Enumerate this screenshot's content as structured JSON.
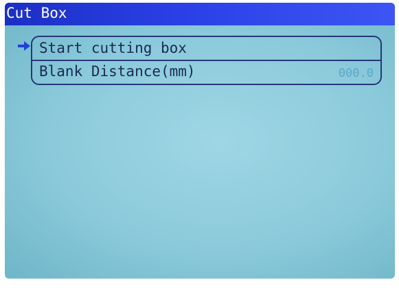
{
  "window": {
    "title": "Cut Box"
  },
  "menu": {
    "items": [
      {
        "label": "Start cutting box",
        "selected": true
      },
      {
        "label": "Blank Distance(mm)",
        "value": "000.0"
      }
    ]
  },
  "colors": {
    "titlebar": "#2a40e6",
    "screen_background": "#8bcadb",
    "text": "#1a2a55",
    "value_text": "#5aa8c8",
    "selection_arrow": "#2440d8"
  },
  "icons": {
    "selection": "arrow-right-icon"
  }
}
